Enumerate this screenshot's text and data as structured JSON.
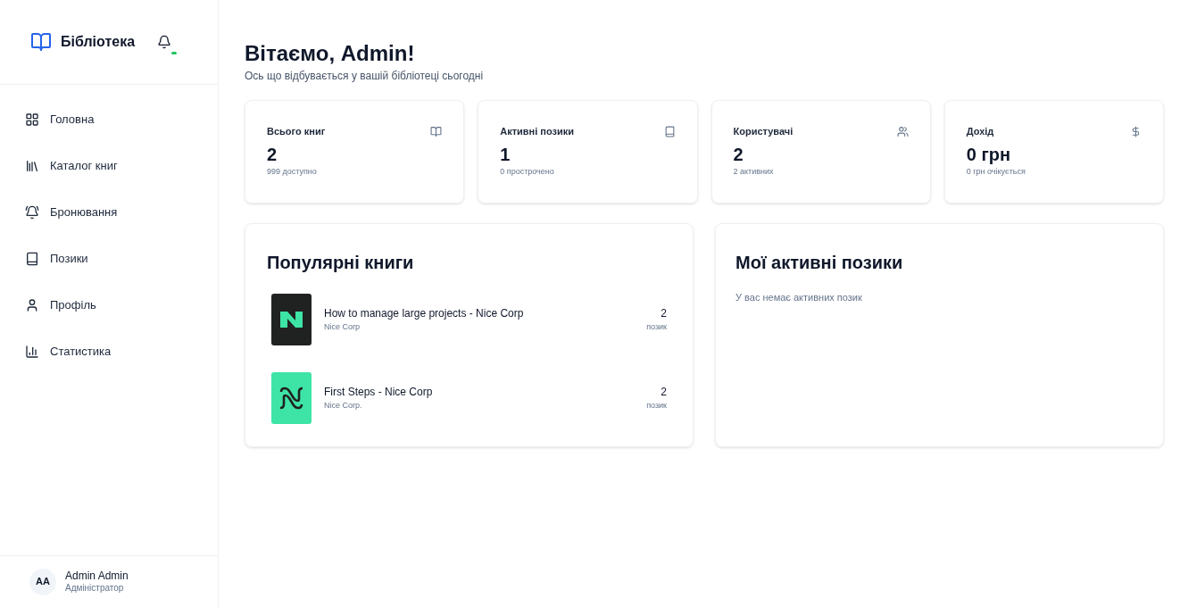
{
  "sidebar": {
    "brand": "Бібліотека",
    "items": [
      {
        "kind": "grid",
        "label": "Головна"
      },
      {
        "kind": "library",
        "label": "Каталог книг"
      },
      {
        "kind": "bell",
        "label": "Бронювання"
      },
      {
        "kind": "book",
        "label": "Позики"
      },
      {
        "kind": "user",
        "label": "Профіль"
      },
      {
        "kind": "chart",
        "label": "Статистика"
      }
    ],
    "user": {
      "initials": "AA",
      "name": "Admin Admin",
      "role": "Адміністратор"
    }
  },
  "header": {
    "title": "Вітаємо, Admin!",
    "subtitle": "Ось що відбувається у вашій бібліотеці сьогодні"
  },
  "stats": [
    {
      "kind": "books",
      "label": "Всього книг",
      "value": "2",
      "note": "999 доступно"
    },
    {
      "kind": "loans",
      "label": "Активні позики",
      "value": "1",
      "note": "0 прострочено"
    },
    {
      "kind": "users",
      "label": "Користувачі",
      "value": "2",
      "note": "2 активних"
    },
    {
      "kind": "income",
      "label": "Дохід",
      "value": "0 грн",
      "note": "0 грн очікується"
    }
  ],
  "popular": {
    "title": "Популярні книги",
    "books": [
      {
        "kind": "dark",
        "title": "How to manage large projects - Nice Corp",
        "author": "Nice Corp",
        "count": "2",
        "unit": "позик"
      },
      {
        "kind": "mint",
        "title": "First Steps - Nice Corp",
        "author": "Nice Corp.",
        "count": "2",
        "unit": "позик"
      }
    ]
  },
  "my_loans": {
    "title": "Мої активні позики",
    "empty": "У вас немає активних позик"
  }
}
